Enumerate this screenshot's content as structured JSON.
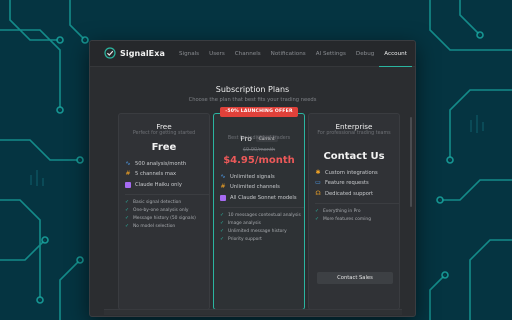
{
  "app": {
    "name": "SignalExa",
    "tabs": [
      "Signals",
      "Users",
      "Channels",
      "Notifications",
      "AI Settings",
      "Debug",
      "Account"
    ],
    "active_tab": "Account"
  },
  "page": {
    "title": "Subscription Plans",
    "subtitle": "Choose the plan that best fits your trading needs"
  },
  "plans": {
    "free": {
      "name": "Free",
      "tagline": "Perfect for getting started",
      "price": "Free",
      "features": [
        {
          "icon": "pulse-icon",
          "text": "500 analysis/month"
        },
        {
          "icon": "hash-icon",
          "text": "5 channels max"
        },
        {
          "icon": "robot-icon",
          "text": "Claude Haiku only"
        }
      ],
      "checks": [
        "Basic signal detection",
        "One-by-one analysis only",
        "Message history (50 signals)",
        "No model selection"
      ]
    },
    "pro": {
      "badge": "-50% LAUNCHING OFFER",
      "name": "Pro",
      "current_label": "Current",
      "tagline": "Best for individual traders",
      "old_price": "$9.90/month",
      "price": "$4.95/month",
      "features": [
        {
          "icon": "pulse-icon",
          "text": "Unlimited signals"
        },
        {
          "icon": "hash-icon",
          "text": "Unlimited channels"
        },
        {
          "icon": "robot-icon",
          "text": "All Claude Sonnet models"
        }
      ],
      "checks": [
        "10 messages contextual analysis",
        "Image analysis",
        "Unlimited message history",
        "Priority support"
      ]
    },
    "enterprise": {
      "name": "Enterprise",
      "tagline": "For professional trading teams",
      "price": "Contact Us",
      "features": [
        {
          "icon": "puzzle-icon",
          "text": "Custom integrations"
        },
        {
          "icon": "chat-icon",
          "text": "Feature requests"
        },
        {
          "icon": "headset-icon",
          "text": "Dedicated support"
        }
      ],
      "checks": [
        "Everything in Pro",
        "More features coming"
      ],
      "cta": "Contact Sales"
    }
  },
  "colors": {
    "accent": "#2bb5a0",
    "sale": "#ec5959",
    "badge": "#e0413a",
    "icon_pulse": "#4fa3f7",
    "icon_hash": "#f5a524",
    "icon_robot": "#a66bf2"
  }
}
